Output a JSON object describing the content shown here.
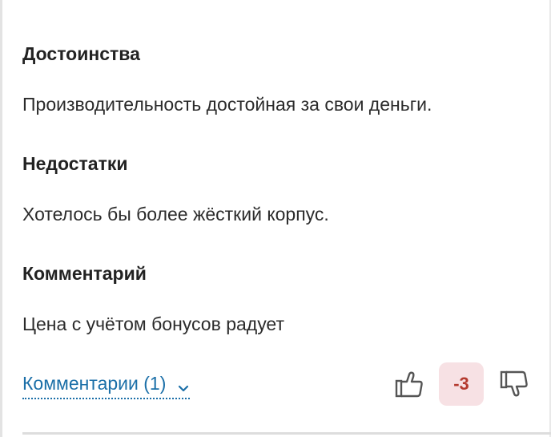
{
  "review": {
    "pros_title": "Достоинства",
    "pros_text": "Производительность достойная за свои деньги.",
    "cons_title": "Недостатки",
    "cons_text": "Хотелось бы более жёсткий корпус.",
    "comment_title": "Комментарий",
    "comment_text": "Цена с учётом бонусов радует"
  },
  "footer": {
    "comments_link_label": "Комментарии (1)",
    "chevron_icon": "chevron-down-icon",
    "thumb_up_icon": "thumb-up-icon",
    "thumb_down_icon": "thumb-down-icon",
    "vote_score": "-3"
  },
  "colors": {
    "link": "#1b6fa8",
    "score_text": "#b43a2f",
    "score_background": "#f7e1e4",
    "text": "#222222"
  }
}
